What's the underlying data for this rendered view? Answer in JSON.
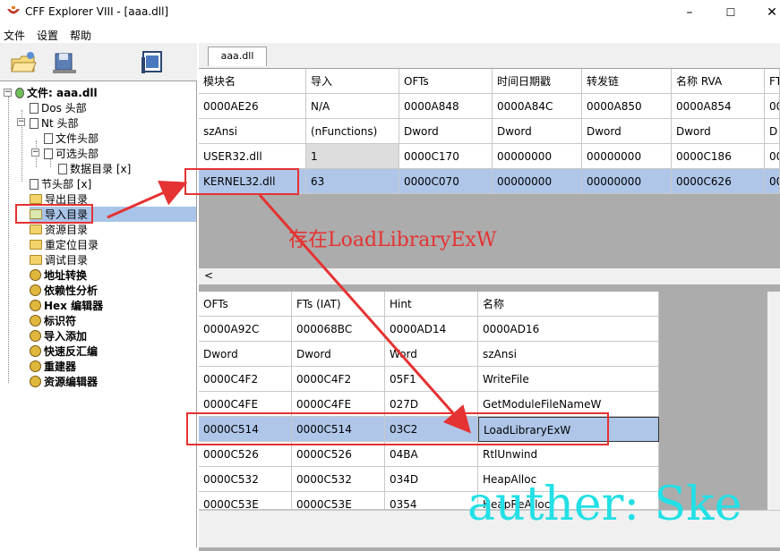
{
  "window": {
    "title": "CFF Explorer VIII - [aaa.dll]",
    "min_glyph": "–",
    "max_glyph": "☐",
    "close_glyph": "✕"
  },
  "menu": [
    "文件",
    "设置",
    "帮助"
  ],
  "tab": {
    "label": "aaa.dll"
  },
  "tree": [
    {
      "label": "文件: aaa.dll",
      "bold": true,
      "icon": "file-icon"
    },
    {
      "label": "Dos 头部",
      "icon": "doc-icon"
    },
    {
      "label": "Nt 头部",
      "icon": "doc-icon"
    },
    {
      "label": "文件头部",
      "icon": "doc-icon"
    },
    {
      "label": "可选头部",
      "icon": "doc-icon"
    },
    {
      "label": "数据目录 [x]",
      "icon": "doc-icon"
    },
    {
      "label": "节头部 [x]",
      "icon": "doc-icon"
    },
    {
      "label": "导出目录",
      "icon": "folder-icon"
    },
    {
      "label": "导入目录",
      "icon": "folder-open-icon",
      "selected": true
    },
    {
      "label": "资源目录",
      "icon": "folder-icon"
    },
    {
      "label": "重定位目录",
      "icon": "folder-icon"
    },
    {
      "label": "调试目录",
      "icon": "folder-icon"
    },
    {
      "label": "地址转换",
      "bold": true,
      "icon": "tool-icon"
    },
    {
      "label": "依赖性分析",
      "bold": true,
      "icon": "tool-icon"
    },
    {
      "label": "Hex 编辑器",
      "bold": true,
      "icon": "tool-icon"
    },
    {
      "label": "标识符",
      "bold": true,
      "icon": "tool-icon"
    },
    {
      "label": "导入添加",
      "bold": true,
      "icon": "tool-icon"
    },
    {
      "label": "快速反汇编",
      "bold": true,
      "icon": "tool-icon"
    },
    {
      "label": "重建器",
      "bold": true,
      "icon": "tool-icon"
    },
    {
      "label": "资源编辑器",
      "bold": true,
      "icon": "tool-icon"
    }
  ],
  "modules_table": {
    "columns": [
      "模块名",
      "导入",
      "OFTs",
      "时间日期戳",
      "转发链",
      "名称 RVA",
      "FT"
    ],
    "rows": [
      [
        "0000AE26",
        "N/A",
        "0000A848",
        "0000A84C",
        "0000A850",
        "0000A854",
        "00"
      ],
      [
        "szAnsi",
        "(nFunctions)",
        "Dword",
        "Dword",
        "Dword",
        "Dword",
        "D"
      ],
      [
        "USER32.dll",
        "1",
        "0000C170",
        "00000000",
        "00000000",
        "0000C186",
        "00"
      ],
      [
        "KERNEL32.dll",
        "63",
        "0000C070",
        "00000000",
        "00000000",
        "0000C626",
        "00"
      ]
    ],
    "selected_row": 3
  },
  "scroll_left_glyph": "<",
  "functions_table": {
    "columns": [
      "OFTs",
      "FTs (IAT)",
      "Hint",
      "名称"
    ],
    "rows": [
      [
        "0000A92C",
        "000068BC",
        "0000AD14",
        "0000AD16"
      ],
      [
        "Dword",
        "Dword",
        "Word",
        "szAnsi"
      ],
      [
        "0000C4F2",
        "0000C4F2",
        "05F1",
        "WriteFile"
      ],
      [
        "0000C4FE",
        "0000C4FE",
        "027D",
        "GetModuleFileNameW"
      ],
      [
        "0000C514",
        "0000C514",
        "03C2",
        "LoadLibraryExW"
      ],
      [
        "0000C526",
        "0000C526",
        "04BA",
        "RtlUnwind"
      ],
      [
        "0000C532",
        "0000C532",
        "034D",
        "HeapAlloc"
      ],
      [
        "0000C53E",
        "0000C53E",
        "0354",
        "HeapReAlloc"
      ]
    ],
    "selected_row": 4
  },
  "annotation": {
    "text": "存在LoadLibraryExW",
    "color": "#e53232"
  },
  "watermark": {
    "text": "auther: Ske",
    "color": "#22e0e6"
  }
}
